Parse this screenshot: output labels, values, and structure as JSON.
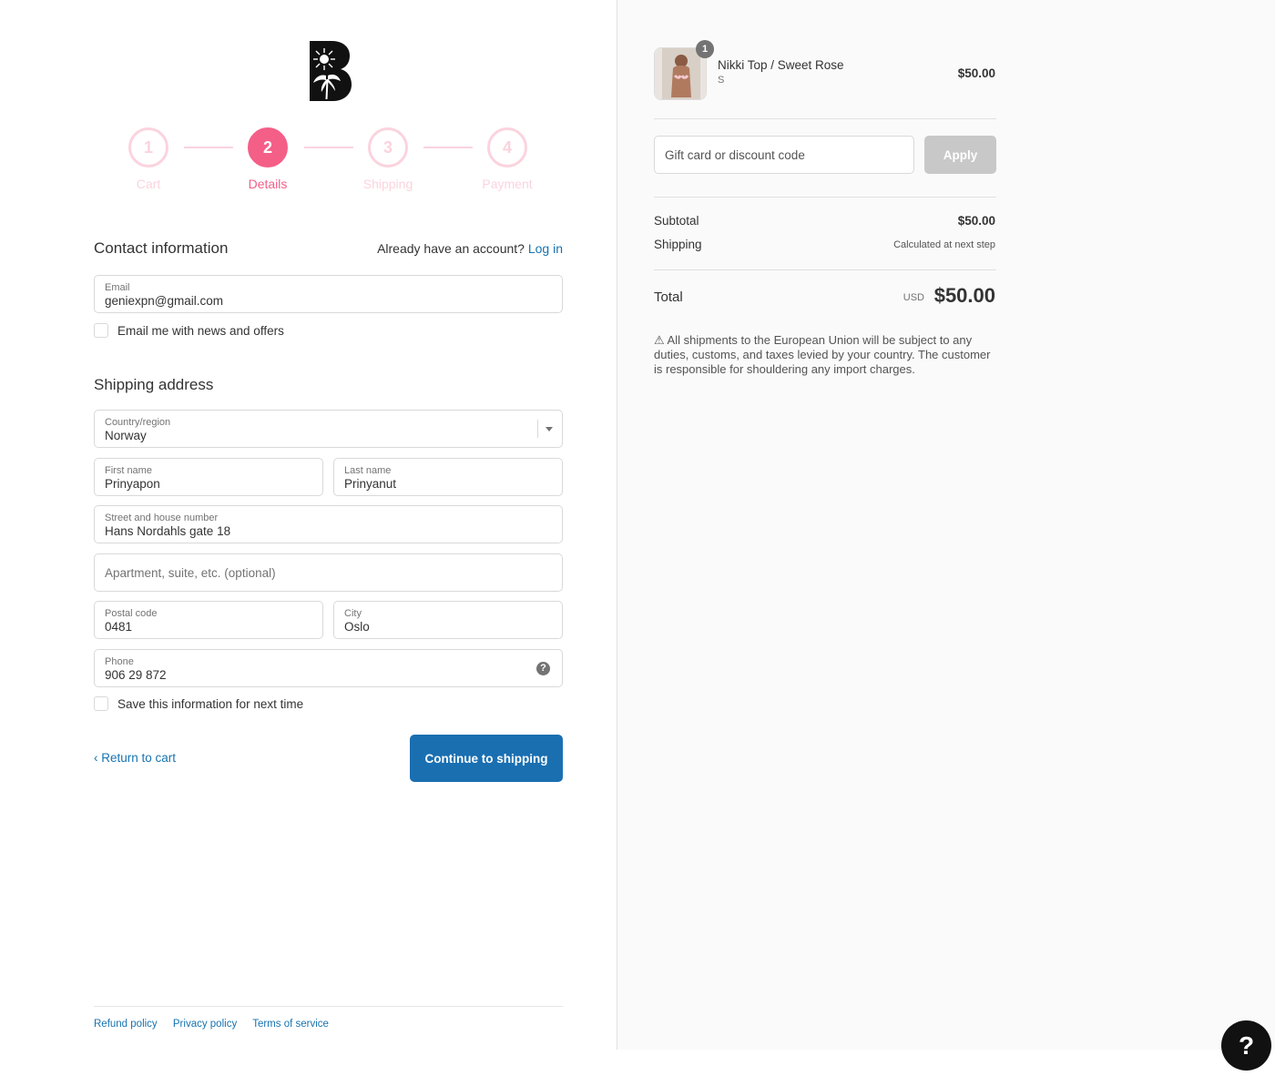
{
  "steps": [
    {
      "num": "1",
      "label": "Cart"
    },
    {
      "num": "2",
      "label": "Details"
    },
    {
      "num": "3",
      "label": "Shipping"
    },
    {
      "num": "4",
      "label": "Payment"
    }
  ],
  "contact": {
    "title": "Contact information",
    "account_prompt": "Already have an account?",
    "login_link": "Log in",
    "email_label": "Email",
    "email_value": "geniexpn@gmail.com",
    "newsletter_label": "Email me with news and offers"
  },
  "shipping": {
    "title": "Shipping address",
    "country_label": "Country/region",
    "country_value": "Norway",
    "first_name_label": "First name",
    "first_name_value": "Prinyapon",
    "last_name_label": "Last name",
    "last_name_value": "Prinyanut",
    "street_label": "Street and house number",
    "street_value": "Hans Nordahls gate 18",
    "apartment_placeholder": "Apartment, suite, etc. (optional)",
    "postal_label": "Postal code",
    "postal_value": "0481",
    "city_label": "City",
    "city_value": "Oslo",
    "phone_label": "Phone",
    "phone_value": "906 29 872",
    "save_info_label": "Save this information for next time"
  },
  "actions": {
    "return_label": "Return to cart",
    "continue_label": "Continue to shipping"
  },
  "footer": {
    "refund": "Refund policy",
    "privacy": "Privacy policy",
    "terms": "Terms of service"
  },
  "summary": {
    "product_name": "Nikki Top / Sweet Rose",
    "product_variant": "S",
    "product_qty": "1",
    "product_price": "$50.00",
    "discount_placeholder": "Gift card or discount code",
    "apply_label": "Apply",
    "subtotal_label": "Subtotal",
    "subtotal_value": "$50.00",
    "shipping_label": "Shipping",
    "shipping_value": "Calculated at next step",
    "total_label": "Total",
    "total_currency": "USD",
    "total_value": "$50.00",
    "notice": "⚠ All shipments to the European Union will be subject to any duties, customs, and taxes levied by your country. The customer is responsible for shouldering any import charges."
  },
  "help_fab": "?",
  "colors": {
    "accent_pink": "#f45f87",
    "pink_light": "#fbd3de",
    "primary_blue": "#1a6fb1",
    "link_blue": "#1773b0"
  }
}
